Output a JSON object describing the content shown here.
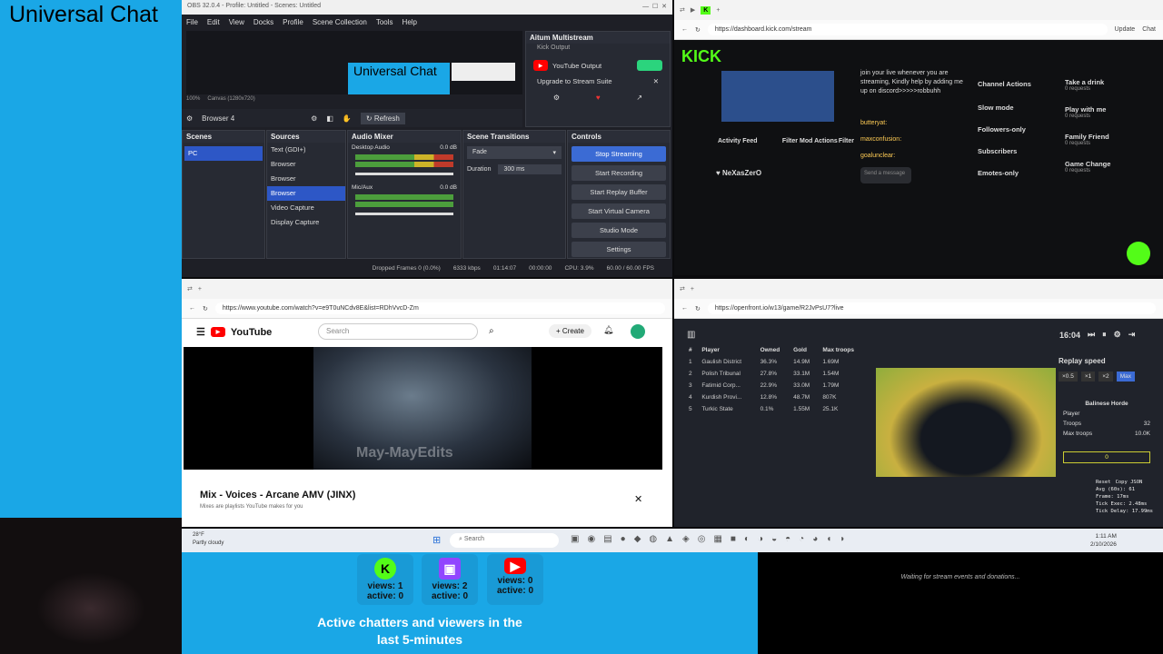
{
  "left": {
    "title": "Universal Chat"
  },
  "obs": {
    "window_title": "OBS 32.0.4 - Profile: Untitled - Scenes: Untitled",
    "menu": [
      "File",
      "Edit",
      "View",
      "Docks",
      "Profile",
      "Scene Collection",
      "Tools",
      "Help"
    ],
    "preview_label": "Universal Chat",
    "zoom": "100%",
    "canvas": "Canvas (1280x720)",
    "source_selected": "Browser 4",
    "refresh": "Refresh",
    "multistream": {
      "title": "Aitum Multistream",
      "kick_output": "Kick Output",
      "youtube_output": "YouTube Output",
      "upgrade": "Upgrade to Stream Suite"
    },
    "docks": {
      "scenes": "Scenes",
      "sources": "Sources",
      "mixer": "Audio Mixer",
      "transitions": "Scene Transitions",
      "controls": "Controls"
    },
    "scenes": [
      "PC"
    ],
    "sources": [
      "Text (GDI+)",
      "Browser",
      "Browser",
      "Browser",
      "Video Capture",
      "Display Capture"
    ],
    "mixer": [
      {
        "name": "Desktop Audio",
        "db": "0.0 dB"
      },
      {
        "name": "Mic/Aux",
        "db": "0.0 dB"
      }
    ],
    "transition": "Fade",
    "duration_label": "Duration",
    "duration": "300 ms",
    "controls": [
      "Stop Streaming",
      "Start Recording",
      "Start Replay Buffer",
      "Start Virtual Camera",
      "Studio Mode",
      "Settings"
    ],
    "status": {
      "dropped": "Dropped Frames 0 (0.0%)",
      "bitrate": "6333 kbps",
      "live": "01:14:07",
      "rec": "00:00:00",
      "cpu": "CPU: 3.9%",
      "fps": "60.00 / 60.00 FPS"
    }
  },
  "kick": {
    "url": "https://dashboard.kick.com/stream",
    "update": "Update",
    "chat": "Chat",
    "logo": "KICK",
    "chat_text": "join your live whenever you are streaming, Kindly help by adding me up on discord>>>>>robbuhh",
    "chat_users": [
      "butteryat:",
      "maxconfusion:",
      "goalunclear:"
    ],
    "send_placeholder": "Send a message",
    "activity_feed": "Activity Feed",
    "mod_actions": "Mod Actions",
    "filter": "Filter",
    "follower": "NeXasZerO",
    "channel_actions": "Channel Actions",
    "options": [
      "Slow mode",
      "Followers-only",
      "Subscribers",
      "Emotes-only"
    ],
    "rewards": [
      {
        "name": "Take a drink",
        "req": "0 requests"
      },
      {
        "name": "Play with me",
        "req": "0 requests"
      },
      {
        "name": "Family Friend",
        "req": "0 requests"
      },
      {
        "name": "Game Change",
        "req": "0 requests"
      }
    ]
  },
  "youtube": {
    "url": "https://www.youtube.com/watch?v=e9T0uNCdv8E&list=RDhVvcD-Zm",
    "logo": "YouTube",
    "search_placeholder": "Search",
    "create": "Create",
    "watermark": "May-MayEdits",
    "video_title": "Mix - Voices - Arcane AMV (JINX)",
    "subtitle": "Mixes are playlists YouTube makes for you"
  },
  "openfront": {
    "url": "https://openfront.io/w13/game/R2JvPsU7?live",
    "headers": [
      "#",
      "Player",
      "Owned",
      "Gold",
      "Max troops"
    ],
    "rows": [
      [
        "1",
        "Gaulish District",
        "36.3%",
        "14.9M",
        "1.69M"
      ],
      [
        "2",
        "Polish Tribunal",
        "27.8%",
        "33.1M",
        "1.54M"
      ],
      [
        "3",
        "Fatimid Corp...",
        "22.9%",
        "33.0M",
        "1.79M"
      ],
      [
        "4",
        "Kurdish Provi...",
        "12.8%",
        "48.7M",
        "807K"
      ],
      [
        "5",
        "Turkic State",
        "0.1%",
        "1.55M",
        "25.1K"
      ]
    ],
    "time": "16:04",
    "replay_speed": "Replay speed",
    "speeds": [
      "×0.5",
      "×1",
      "×2",
      "Max"
    ],
    "nation": "Balinese Horde",
    "player_label": "Player",
    "troops_label": "Troops",
    "troops": "32",
    "max_troops_label": "Max troops",
    "max_troops": "10.0K",
    "gold": "0",
    "perf": [
      "Reset",
      "Copy JSON",
      "Avg (60s): 61",
      "Frame: 17ms",
      "Tick Exec: 2.48ms",
      "Tick Delay: 17.99ms"
    ]
  },
  "taskbar": {
    "weather_temp": "28°F",
    "weather": "Partly cloudy",
    "search": "Search",
    "time": "1:11 AM",
    "date": "2/10/2026"
  },
  "panel": {
    "stats": [
      {
        "views": "views: 1",
        "active": "active: 0",
        "color": "#53fc18",
        "glyph": "K"
      },
      {
        "views": "views: 2",
        "active": "active: 0",
        "color": "#9146ff",
        "glyph": "▣"
      },
      {
        "views": "views: 0",
        "active": "active: 0",
        "color": "#ff0000",
        "glyph": "▶"
      }
    ],
    "caption": "Active chatters and viewers in the last 5-minutes"
  },
  "waiting": "Waiting for stream events and donations..."
}
